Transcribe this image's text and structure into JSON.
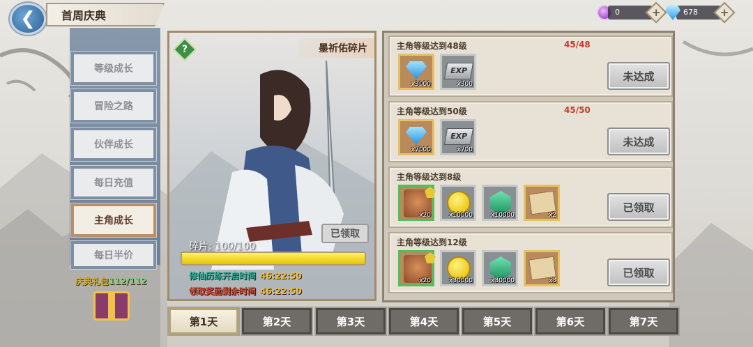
{
  "header": {
    "title": "首周庆典",
    "resources": [
      {
        "icon": "purple-orb-icon",
        "value": "0"
      },
      {
        "icon": "diamond-icon",
        "value": "678"
      }
    ]
  },
  "sidebar": {
    "items": [
      {
        "label": "等级成长",
        "active": false
      },
      {
        "label": "冒险之路",
        "active": false
      },
      {
        "label": "伙伴成长",
        "active": false
      },
      {
        "label": "每日充值",
        "active": false
      },
      {
        "label": "主角成长",
        "active": true
      },
      {
        "label": "每日半价",
        "active": false
      }
    ],
    "gift": {
      "label": "庆典礼包",
      "count": "112/112"
    }
  },
  "hero": {
    "name": "墨祈佑碎片",
    "claimed_label": "已领取",
    "fragments_label": "碎片: 100/100",
    "progress": 1.0,
    "timers": [
      {
        "label": "修仙历练开启时间",
        "time": "46:22:50",
        "color": "teal"
      },
      {
        "label": "领取奖励剩余时间",
        "time": "46:22:50",
        "color": "red"
      }
    ]
  },
  "tasks": [
    {
      "title": "主角等级达到48级",
      "progress": "45/48",
      "button": "未达成",
      "rewards": [
        {
          "type": "gem",
          "count": "x3000"
        },
        {
          "type": "exp",
          "label": "EXP",
          "count": "x300"
        }
      ]
    },
    {
      "title": "主角等级达到50级",
      "progress": "45/50",
      "button": "未达成",
      "rewards": [
        {
          "type": "gem",
          "count": "x7000"
        },
        {
          "type": "exp",
          "label": "EXP",
          "count": "x700"
        }
      ]
    },
    {
      "title": "主角等级达到8级",
      "progress": "",
      "button": "已领取",
      "rewards": [
        {
          "type": "face",
          "count": "x20"
        },
        {
          "type": "coin",
          "count": "x10000"
        },
        {
          "type": "jade",
          "count": "x10000"
        },
        {
          "type": "scroll",
          "count": "x2"
        }
      ]
    },
    {
      "title": "主角等级达到12级",
      "progress": "",
      "button": "已领取",
      "rewards": [
        {
          "type": "face",
          "count": "x20"
        },
        {
          "type": "coin",
          "count": "x30000"
        },
        {
          "type": "jade",
          "count": "x30000"
        },
        {
          "type": "scroll",
          "count": "x3"
        }
      ]
    }
  ],
  "days": [
    {
      "label": "第1天",
      "active": true
    },
    {
      "label": "第2天",
      "active": false
    },
    {
      "label": "第3天",
      "active": false
    },
    {
      "label": "第4天",
      "active": false
    },
    {
      "label": "第5天",
      "active": false
    },
    {
      "label": "第6天",
      "active": false
    },
    {
      "label": "第7天",
      "active": false
    }
  ]
}
